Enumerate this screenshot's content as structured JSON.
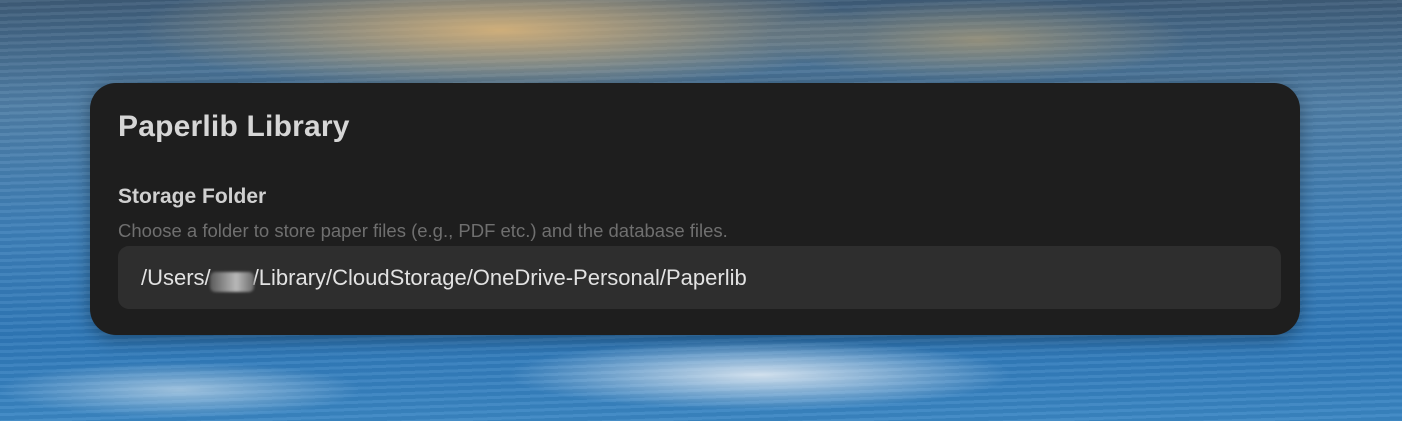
{
  "panel": {
    "title": "Paperlib Library"
  },
  "storage": {
    "label": "Storage Folder",
    "description": "Choose a folder to store paper files (e.g., PDF etc.) and the database files.",
    "path_prefix": "/Users/",
    "path_suffix": "/Library/CloudStorage/OneDrive-Personal/Paperlib"
  }
}
